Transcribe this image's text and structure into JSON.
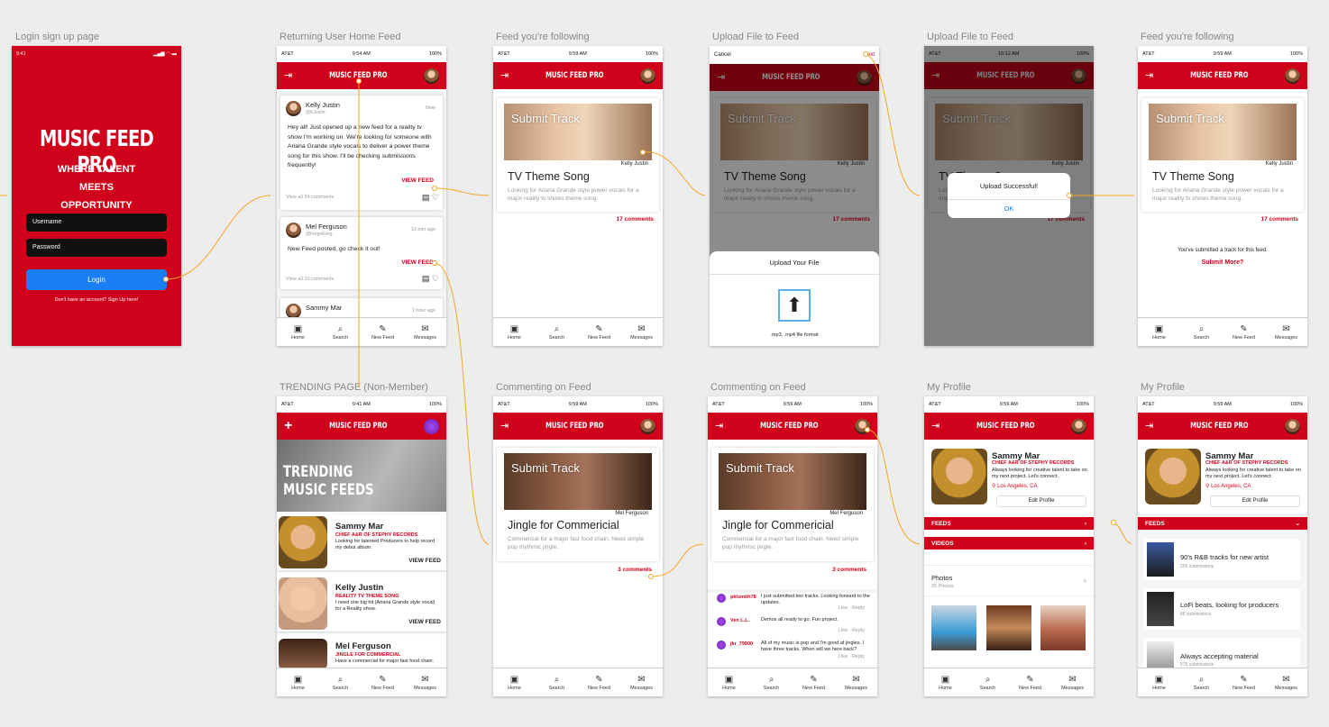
{
  "brand": "MUSIC FEED PRO",
  "tabs": [
    "Home",
    "Search",
    "New Feed",
    "Messages"
  ],
  "screen_titles": [
    "Login sign up page",
    "Returning User Home Feed",
    "Feed you're following",
    "Upload File to Feed",
    "Upload File to Feed",
    "Feed you're following",
    "TRENDING PAGE (Non-Member)",
    "Commenting on Feed",
    "Commenting on Feed",
    "My Profile",
    "My Profile"
  ],
  "status": {
    "carrier": "AT&T",
    "battery": "100%",
    "t1": "9:41",
    "t2": "9:54 AM",
    "t3": "9:59 AM",
    "t4": "10:12 AM",
    "t5": "9:41 AM"
  },
  "login": {
    "title": "MUSIC FEED PRO",
    "tagline": "WHERE TALENT MEETS OPPORTUNITY",
    "username": "Username",
    "password": "Password",
    "button": "Login",
    "signup": "Don't have an account? Sign Up here!"
  },
  "home": {
    "p1_name": "Kelly Justin",
    "p1_handle": "@KJustin",
    "p1_time": "Now",
    "p1_text": "Hey all! Just opened up a new feed for a reality tv show I'm working on. We're looking for someone with Ariana Grande style vocals to deliver a power theme song for this show. I'll be checking submissions frequently!",
    "view": "VIEW FEED",
    "p1_comments": "View all 24 comments",
    "p2_name": "Mel Ferguson",
    "p2_handle": "@FergieFerg",
    "p2_time": "12 min ago",
    "p2_text": "New Feed posted, go check it out!",
    "p2_comments": "View all 10 comments",
    "p3_name": "Sammy Mar",
    "p3_time": "1 hour ago"
  },
  "feed": {
    "submit": "Submit Track",
    "title": "TV Theme Song",
    "artist": "Kelly Justin",
    "desc": "Looking for Ariana Grande style power vocals for a major reality tv shows theme song.",
    "comments": "17 comments",
    "submitted": "You've submitted a track for this feed.",
    "more": "Submit More?"
  },
  "upload": {
    "cancel": "Cancel",
    "next": "Next",
    "sheet_title": "Upload Your File",
    "format": ".mp3, .mp4 file format",
    "success": "Upload Successful!",
    "ok": "OK"
  },
  "trending": {
    "title": "TRENDING MUSIC FEEDS",
    "rows": [
      {
        "name": "Sammy Mar",
        "role": "CHIEF A&R OF STEPHY RECORDS",
        "desc": "Looking for talented Producers to help record my debut album."
      },
      {
        "name": "Kelly Justin",
        "role": "REALITY TV THEME SONG",
        "desc": "I need one big hit (Ariana Grande style vocal) for a Reality show."
      },
      {
        "name": "Mel Ferguson",
        "role": "JINGLE FOR COMMERCIAL",
        "desc": "Have a commercial for major fast food chain."
      }
    ]
  },
  "jingle": {
    "title": "Jingle for Commericial",
    "artist": "Mel Ferguson",
    "desc": "Commercial for a major fast food chain. Need simple pop rhythmic jingle.",
    "comments": "3 comments"
  },
  "comments": [
    {
      "user": "pklsmith78",
      "text": "I just submitted two tracks. Looking forward to the updates."
    },
    {
      "user": "Ven L.L.",
      "text": "Demos all ready to go. Fun project."
    },
    {
      "user": "jkr_79900",
      "text": "All of my music is pop and I'm good at jingles. I have three tracks. When will we here back?"
    }
  ],
  "like": "Like",
  "reply": "Reply",
  "profile": {
    "name": "Sammy Mar",
    "role": "CHIEF A&R OF STEPHY RECORDS",
    "bio": "Always looking for creative talent to take on my next project. Let's connect.",
    "location": "Los Angeles, CA",
    "edit": "Edit Profile",
    "feeds": "FEEDS",
    "videos": "VIDEOS",
    "photos": "Photos",
    "photo_count": "25 Photos",
    "feeds_list": [
      {
        "title": "90's R&B tracks for new artist",
        "sub": "200 submissions"
      },
      {
        "title": "LoFi beats, looking for producers",
        "sub": "88 submissions"
      },
      {
        "title": "Always accepting material",
        "sub": "578 submissions"
      }
    ]
  },
  "colors": {
    "brand_red": "#d0021b",
    "login_blue": "#1a7ef5",
    "arrow": "#f5a623"
  }
}
